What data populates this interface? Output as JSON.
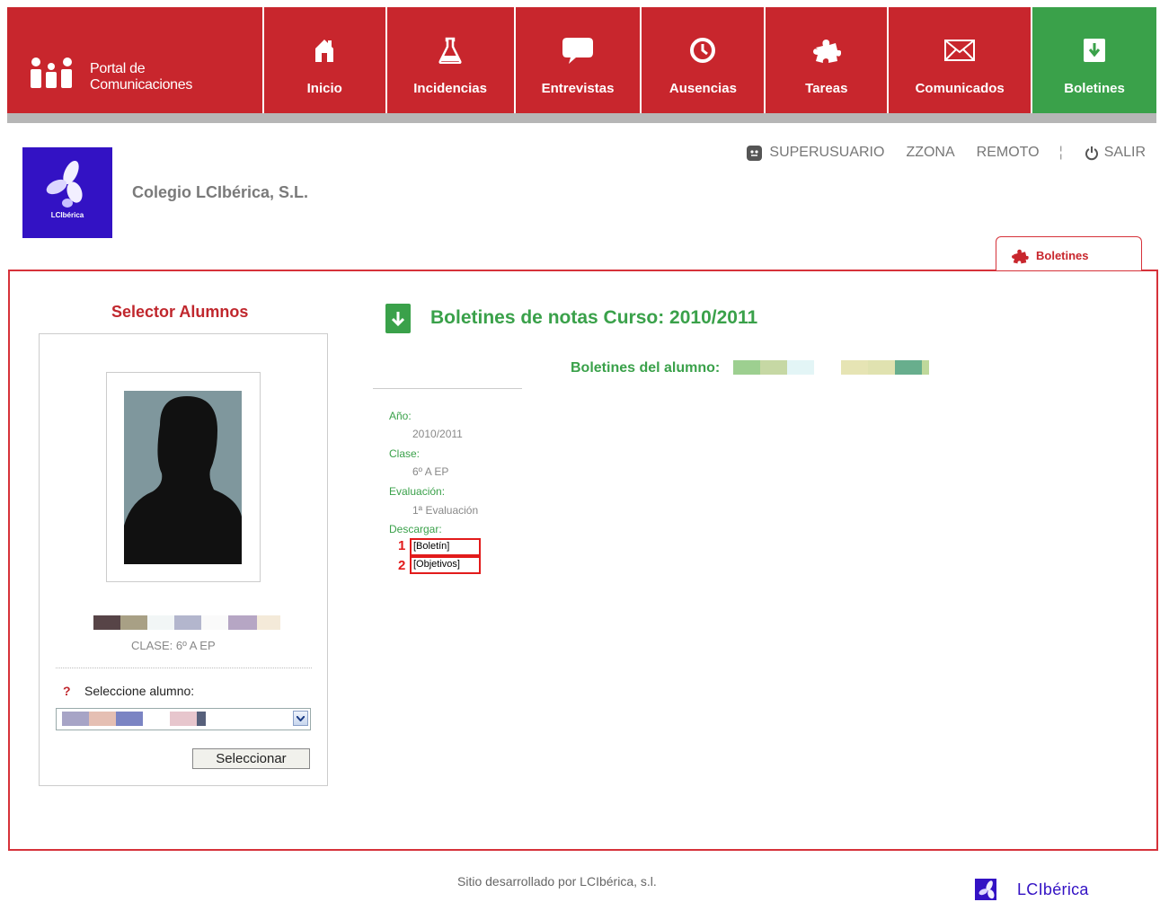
{
  "brand": {
    "line1": "Portal de",
    "line2": "Comunicaciones"
  },
  "nav": [
    {
      "label": "Inicio",
      "icon": "home-icon"
    },
    {
      "label": "Incidencias",
      "icon": "flask-icon"
    },
    {
      "label": "Entrevistas",
      "icon": "speech-bubble-icon"
    },
    {
      "label": "Ausencias",
      "icon": "clock-icon"
    },
    {
      "label": "Tareas",
      "icon": "puzzle-icon"
    },
    {
      "label": "Comunicados",
      "icon": "envelope-icon"
    },
    {
      "label": "Boletines",
      "icon": "download-icon",
      "active": true
    }
  ],
  "school": {
    "logo_caption": "LCIbérica",
    "name": "Colegio LCIbérica, S.L."
  },
  "user_nav": {
    "user": "SUPERUSUARIO",
    "zone": "ZZONA",
    "remote": "REMOTO",
    "separator": "¦",
    "logout": "SALIR"
  },
  "tab": {
    "label": "Boletines"
  },
  "selector": {
    "title": "Selector Alumnos",
    "class_line": "CLASE: 6º A EP",
    "select_label": "Seleccione alumno:",
    "select_button": "Seleccionar"
  },
  "boletines": {
    "title": "Boletines de notas Curso: 2010/2011",
    "student_label": "Boletines del alumno:",
    "fields": {
      "year_label": "Año:",
      "year_value": "2010/2011",
      "class_label": "Clase:",
      "class_value": "6º A EP",
      "eval_label": "Evaluación:",
      "eval_value": "1ª Evaluación",
      "download_label": "Descargar:"
    },
    "downloads": [
      {
        "number": "1",
        "label": "[Boletín]"
      },
      {
        "number": "2",
        "label": "[Objetivos]"
      }
    ]
  },
  "footer": {
    "text": "Sitio desarrollado por LCIbérica, s.l.",
    "brand": "LCIbérica"
  },
  "colors": {
    "nav_red": "#c8262d",
    "active_green": "#3aa14a",
    "brand_purple": "#3312c4",
    "highlight_red": "#e21b1b"
  }
}
